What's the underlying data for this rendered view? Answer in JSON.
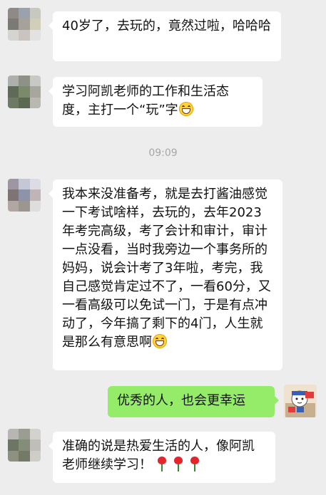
{
  "chat": {
    "messages": [
      {
        "side": "in",
        "text": "40岁了，去玩的，竟然过啦，哈哈哈"
      },
      {
        "side": "in",
        "text": "学习阿凯老师的工作和生活态度，主打一个“玩”字",
        "emoji": "grin-emoji"
      },
      {
        "side": "in",
        "text": "我本来没准备考，就是去打酱油感觉一下考试啥样，去玩的，去年2023年考完高级，考了会计和审计，审计一点没看，当时我旁边一个事务所的妈妈，说会计考了3年啦，考完，我自己感觉肯定过不了，一看60分，又一看高级可以免试一门，于是有点冲动了，今年搞了剩下的4门，人生就是那么有意思啊",
        "emoji": "grin-emoji"
      },
      {
        "side": "out",
        "text": "优秀的人，也会更幸运"
      },
      {
        "side": "in",
        "text": "准确的说是热爱生活的人，像阿凯老师继续学习！",
        "emoji": "rose-emoji"
      }
    ],
    "timestamp": "09:09"
  },
  "colors": {
    "background": "#ededed",
    "incoming_bubble": "#ffffff",
    "outgoing_bubble": "#95ec69",
    "timestamp_text": "#a6a6a6"
  }
}
